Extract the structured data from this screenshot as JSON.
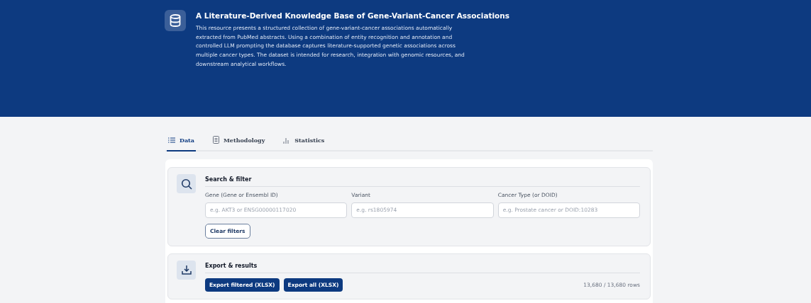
{
  "header": {
    "title": "A Literature-Derived Knowledge Base of Gene-Variant-Cancer Associations",
    "description": "This resource presents a structured collection of gene-variant-cancer associations automatically extracted from PubMed abstracts. Using a combination of entity recognition and annotation and controlled LLM prompting the database captures literature-supported genetic associations across multiple cancer types. The dataset is intended for research, integration with genomic resources, and downstream analytical workflows."
  },
  "tabs": [
    {
      "label": "Data",
      "kind": "list",
      "selected": true
    },
    {
      "label": "Methodology",
      "kind": "doc",
      "selected": false
    },
    {
      "label": "Statistics",
      "kind": "chart",
      "selected": false
    }
  ],
  "search_filter": {
    "title": "Search & filter",
    "fields": [
      {
        "label": "Gene (Gene or Ensembl ID)",
        "placeholder": "e.g. AKT3 or ENSG00000117020"
      },
      {
        "label": "Variant",
        "placeholder": "e.g. rs1805974"
      },
      {
        "label": "Cancer Type (or DOID)",
        "placeholder": "e.g. Prostate cancer or DOID:10283"
      }
    ],
    "clear_button": "Clear filters"
  },
  "export": {
    "title": "Export & results",
    "buttons": [
      "Export filtered (XLSX)",
      "Export all (XLSX)"
    ],
    "row_count": "13,680 / 13,680 rows"
  }
}
